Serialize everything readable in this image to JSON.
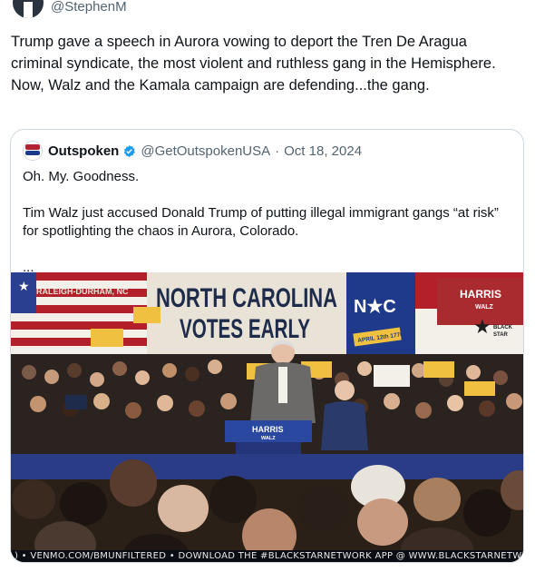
{
  "tweet": {
    "handle": "@StephenM",
    "text": "Trump gave a speech in Aurora vowing to deport the Tren De Aragua criminal syndicate, the most violent and ruthless gang in the Hemisphere. Now, Walz and the Kamala campaign are defending...the gang."
  },
  "quote": {
    "name": "Outspoken",
    "handle": "@GetOutspokenUSA",
    "separator": "·",
    "date": "Oct 18, 2024",
    "line1": "Oh. My. Goodness.",
    "line2": "Tim Walz just accused Donald Trump of putting illegal immigrant gangs “at risk” for spotlighting the chaos in Aurora, Colorado.",
    "ellipsis": "...",
    "avatar_icon": "outspoken-logo-icon",
    "verified_color": "#1d9bf0"
  },
  "media": {
    "banner_line1": "NORTH CAROLINA",
    "banner_line2": "VOTES EARLY",
    "flag_letters": "N★C",
    "flag_date": "APRIL 12th 1776",
    "harris_sign_top": "HARRIS",
    "harris_sign_sub": "WALZ",
    "venue_text": "RALEIGH-DURHAM, NC",
    "podium_line1": "HARRIS",
    "podium_line2": "WALZ",
    "black_star_line1": "BLACK",
    "black_star_line2": "STAR",
    "ticker_text": ")  •  VENMO.COM/BMUNFILTERED  •  DOWNLOAD THE #BLACKSTARNETWORK APP @  WWW.BLACKSTARNETWORK",
    "colors": {
      "banner_bg": "#e8e3d6",
      "banner_text": "#1e2b4a",
      "nc_blue": "#1f3a8a",
      "nc_red": "#b3202a",
      "stage_red": "#a92a2f",
      "crowd_dark": "#2a2320"
    }
  }
}
